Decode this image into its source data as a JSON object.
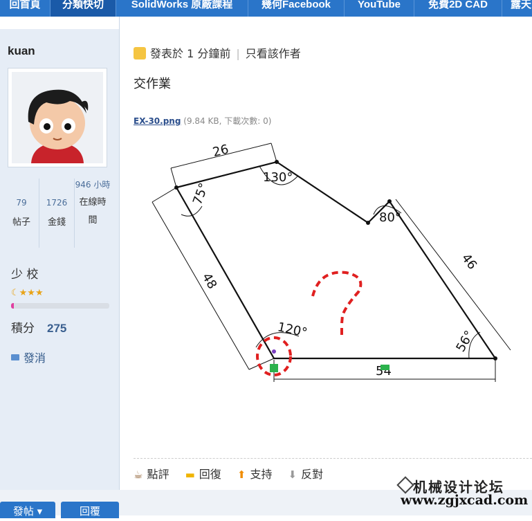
{
  "nav": {
    "items": [
      {
        "label": "回首頁"
      },
      {
        "label": "分類快切"
      },
      {
        "label": "SolidWorks 原廠課程"
      },
      {
        "label": "幾何Facebook"
      },
      {
        "label": "YouTube"
      },
      {
        "label": "免費2D CAD"
      },
      {
        "label": "露天"
      }
    ],
    "active_index": 1
  },
  "user": {
    "name": "kuan",
    "stats": [
      {
        "value": "79",
        "label": "帖子"
      },
      {
        "value": "1726",
        "label": "金錢"
      },
      {
        "value": "946 小時",
        "label": "在線時間"
      }
    ],
    "rank": "少 校",
    "stars": "☾★★★",
    "rank_progress": 0.03,
    "points_label": "積分",
    "points_value": "275",
    "message_label": "發消"
  },
  "post": {
    "meta_posted": "發表於 1 分鐘前",
    "meta_author_only": "只看該作者",
    "title": "交作業",
    "attachment_name": "EX-30.png",
    "attachment_info": "(9.84 KB, 下載次數: 0)",
    "drawing": {
      "dims": [
        "26",
        "130°",
        "75°",
        "80°",
        "46",
        "48",
        "120°",
        "56°",
        "54"
      ],
      "question_mark": "?"
    }
  },
  "actions": [
    {
      "label": "點評",
      "icon": "coffee-icon"
    },
    {
      "label": "回復",
      "icon": "speech-bubble-icon"
    },
    {
      "label": "支持",
      "icon": "arrow-up-icon"
    },
    {
      "label": "反對",
      "icon": "arrow-down-icon"
    }
  ],
  "buttons": {
    "post": "發帖 ▾",
    "reply": "回覆"
  },
  "watermark": {
    "name": "机械设计论坛",
    "url": "www.zgjxcad.com"
  },
  "colors": {
    "nav": "#2a75c9",
    "sidebar": "#e6edf6",
    "accent_red": "#e02020"
  }
}
